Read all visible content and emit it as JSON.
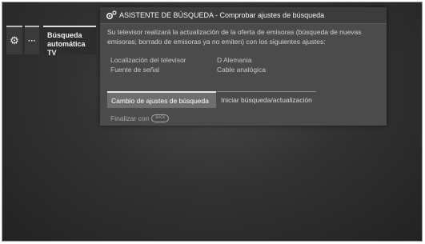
{
  "menu": {
    "gear_icon": "gear-icon",
    "dots_label": "···",
    "search_item_line1": "Búsqueda",
    "search_item_line2": "automática TV"
  },
  "dialog": {
    "icon": "search-settings-icon",
    "title": "ASISTENTE DE BÚSQUEDA - Comprobar ajustes de búsqueda",
    "description": "Su televisor realizará la actualización de la oferta de emisoras (búsqueda de nuevas emisoras; borrado de emisoras ya no emiten) con los siguientes ajustes:",
    "settings": [
      {
        "label": "Localización del televisor",
        "value": "D Alemania"
      },
      {
        "label": "Fuente de señal",
        "value": "Cable analógica"
      }
    ],
    "buttons": {
      "change_label": "Cambio de ajustes de búsqueda",
      "start_label": "Iniciar búsqueda/actualización"
    },
    "footer": {
      "finish_label": "Finalizar con",
      "back_key_label": "BACK"
    }
  },
  "colors": {
    "background": "#333333",
    "dialog": "#4b4b4b",
    "selected_button": "#6e6e6e"
  }
}
